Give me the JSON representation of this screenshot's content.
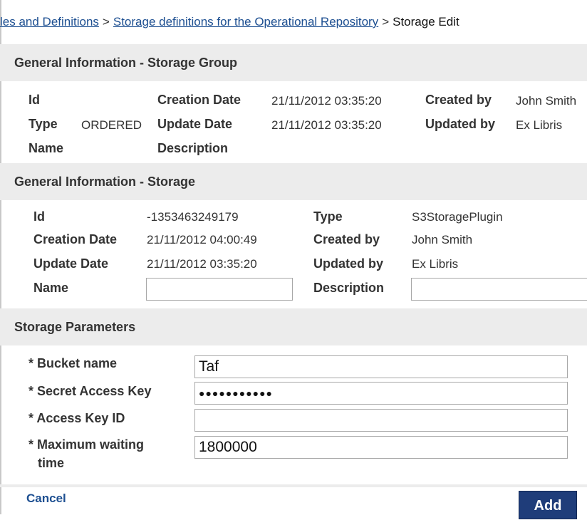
{
  "breadcrumb": {
    "item1": "les and Definitions",
    "item2": "Storage definitions for the Operational Repository",
    "separator": ">",
    "current": "Storage Edit"
  },
  "storage_group": {
    "header": "General Information - Storage Group",
    "id_label": "Id",
    "type_label": "Type",
    "type_value": "ORDERED",
    "name_label": "Name",
    "creation_date_label": "Creation Date",
    "creation_date_value": "21/11/2012 03:35:20",
    "update_date_label": "Update Date",
    "update_date_value": "21/11/2012 03:35:20",
    "description_label": "Description",
    "created_by_label": "Created by",
    "created_by_value": "John Smith",
    "updated_by_label": "Updated by",
    "updated_by_value": "Ex Libris"
  },
  "storage": {
    "header": "General Information - Storage",
    "id_label": "Id",
    "id_value": "-1353463249179",
    "creation_date_label": "Creation Date",
    "creation_date_value": "21/11/2012 04:00:49",
    "update_date_label": "Update Date",
    "update_date_value": "21/11/2012 03:35:20",
    "name_label": "Name",
    "name_value": "",
    "type_label": "Type",
    "type_value": "S3StoragePlugin",
    "created_by_label": "Created by",
    "created_by_value": "John Smith",
    "updated_by_label": "Updated by",
    "updated_by_value": "Ex Libris",
    "description_label": "Description",
    "description_value": ""
  },
  "storage_parameters": {
    "header": "Storage Parameters",
    "bucket_name_label": "* Bucket name",
    "bucket_name_value": "Taf",
    "secret_key_label": "* Secret Access Key",
    "secret_key_value": "●●●●●●●●●●●",
    "access_key_id_label": "* Access Key ID",
    "access_key_id_value": "",
    "max_wait_label_line1": "* Maximum waiting",
    "max_wait_label_line2": "time",
    "max_wait_value": "1800000"
  },
  "footer": {
    "cancel_label": "Cancel",
    "add_label": "Add"
  }
}
